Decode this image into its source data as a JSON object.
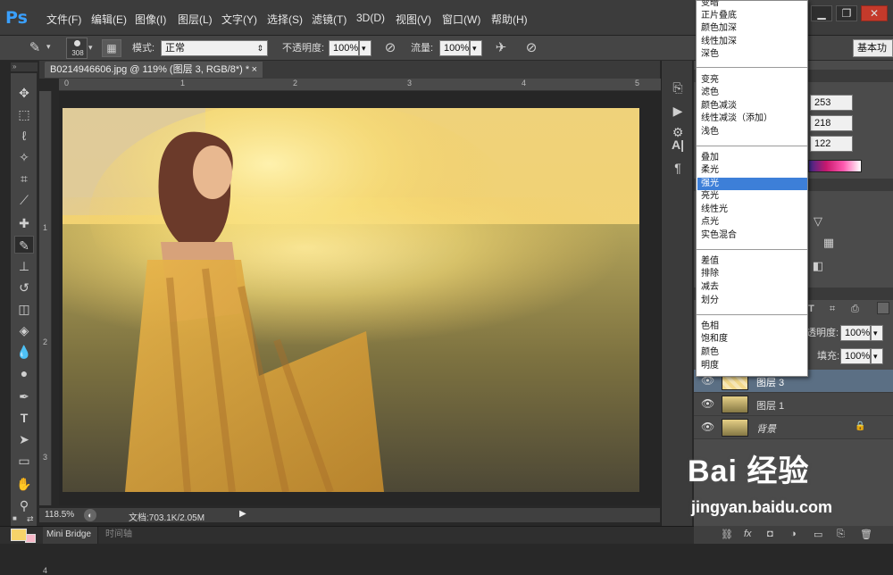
{
  "app": {
    "logo": "Ps"
  },
  "menu": [
    "文件(F)",
    "编辑(E)",
    "图像(I)",
    "图层(L)",
    "文字(Y)",
    "选择(S)",
    "滤镜(T)",
    "3D(D)",
    "视图(V)",
    "窗口(W)",
    "帮助(H)"
  ],
  "window_buttons": [
    "▁",
    "❐",
    "✕"
  ],
  "options": {
    "brush_size": "308",
    "mode_label": "模式:",
    "mode_value": "正常",
    "opacity_label": "不透明度:",
    "opacity_value": "100%",
    "flow_label": "流量:",
    "flow_value": "100%",
    "workspace": "基本功"
  },
  "document": {
    "tab_title": "B0214946606.jpg @ 119% (图层 3, RGB/8*) *",
    "close": "×",
    "ruler_top": [
      "0",
      "1",
      "2",
      "3",
      "4",
      "5"
    ],
    "ruler_left": [
      "1",
      "2",
      "3",
      "4"
    ],
    "zoom": "118.5%",
    "doc_info": "文档:703.1K/2.05M"
  },
  "bottom_tabs": [
    "Mini Bridge",
    "时间轴"
  ],
  "blend_modes": {
    "groups": [
      [
        "变暗",
        "正片叠底",
        "颜色加深",
        "线性加深",
        "深色"
      ],
      [
        "变亮",
        "滤色",
        "颜色减淡",
        "线性减淡（添加）",
        "浅色"
      ],
      [
        "叠加",
        "柔光",
        "强光",
        "亮光",
        "线性光",
        "点光",
        "实色混合"
      ],
      [
        "差值",
        "排除",
        "减去",
        "划分"
      ],
      [
        "色相",
        "饱和度",
        "颜色",
        "明度"
      ]
    ],
    "selected": "强光"
  },
  "color_panel": {
    "r": "253",
    "g": "218",
    "b": "122"
  },
  "layers_panel": {
    "opacity_label": "透明度:",
    "opacity_value": "100%",
    "fill_label": "填充:",
    "fill_value": "100%",
    "layers": [
      {
        "name": "图层 3",
        "selected": true
      },
      {
        "name": "图层 1",
        "selected": false
      },
      {
        "name": "背景",
        "selected": false,
        "locked": true
      }
    ]
  },
  "watermark": {
    "brand": "Bai 经验",
    "url": "jingyan.baidu.com"
  },
  "colors": {
    "accent": "#3d7fd8",
    "fg_swatch": "#f6d36a"
  }
}
